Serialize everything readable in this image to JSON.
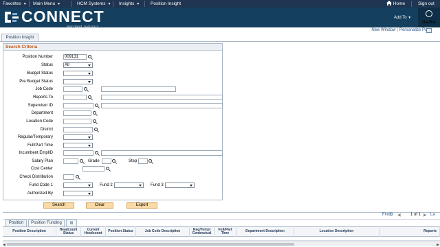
{
  "topbar": {
    "favorites": "Favorites",
    "main_menu": "Main Menu",
    "hcm_systems": "HCM Systems",
    "insights": "Insights",
    "breadcrumb_current": "Position Insight",
    "home": "Home",
    "sign_out": "Sign out"
  },
  "header": {
    "brand": "CONNECT",
    "brand_sub": "Maryland Judiciary",
    "add_to": "Add To",
    "navbar": "NavBar"
  },
  "page_links": {
    "new_window": "New Window",
    "personalize": "Personalize Page"
  },
  "page_tab": "Position Insight",
  "search": {
    "title": "Search Criteria",
    "position_number": {
      "label": "Position Number",
      "value": "009131"
    },
    "status": {
      "label": "Status",
      "value": "All"
    },
    "budget_status": {
      "label": "Budget Status",
      "value": ""
    },
    "pre_budget_status": {
      "label": "Pre Budget Status",
      "value": ""
    },
    "job_code": {
      "label": "Job Code",
      "value": ""
    },
    "reports_to": {
      "label": "Reports To",
      "value": ""
    },
    "supervisor_id": {
      "label": "Supervisor ID",
      "value": ""
    },
    "department": {
      "label": "Department",
      "value": ""
    },
    "location_code": {
      "label": "Location Code",
      "value": ""
    },
    "district": {
      "label": "District",
      "value": ""
    },
    "regular_temporary": {
      "label": "Regular/Temporary",
      "value": ""
    },
    "full_part_time": {
      "label": "Full/Part Time",
      "value": ""
    },
    "incumbent_emplid": {
      "label": "Incumbent EmplID",
      "value": ""
    },
    "salary_plan": {
      "label": "Salary Plan",
      "value": ""
    },
    "grade": {
      "label": "Grade",
      "value": ""
    },
    "step": {
      "label": "Step",
      "value": ""
    },
    "cost_center": {
      "label": "Cost Center",
      "value": ""
    },
    "check_distribution": {
      "label": "Check Distribution",
      "value": ""
    },
    "fund_code_1": {
      "label": "Fund Code 1",
      "value": ""
    },
    "fund_2": {
      "label": "Fund 2",
      "value": ""
    },
    "fund_3": {
      "label": "Fund 3",
      "value": ""
    },
    "authorized_by": {
      "label": "Authorized By",
      "value": ""
    },
    "buttons": {
      "search": "Search",
      "clear": "Clear",
      "export": "Export"
    }
  },
  "results": {
    "find": "Find",
    "pager": "1 of 1",
    "last": "La",
    "tabs": [
      "Position",
      "Position Funding"
    ],
    "columns": [
      "Position Description",
      "Headcount Status",
      "Current Headcount",
      "Position Status",
      "Job Code Description",
      "Reg/Temp/ Contractual",
      "Full/Part Time",
      "Department Description",
      "Location Description",
      "Reports"
    ]
  },
  "colors": {
    "topbar": "#1f3552",
    "header": "#153f5f",
    "criteria_title": "#c45a1c",
    "button": "#f9d9a4"
  }
}
